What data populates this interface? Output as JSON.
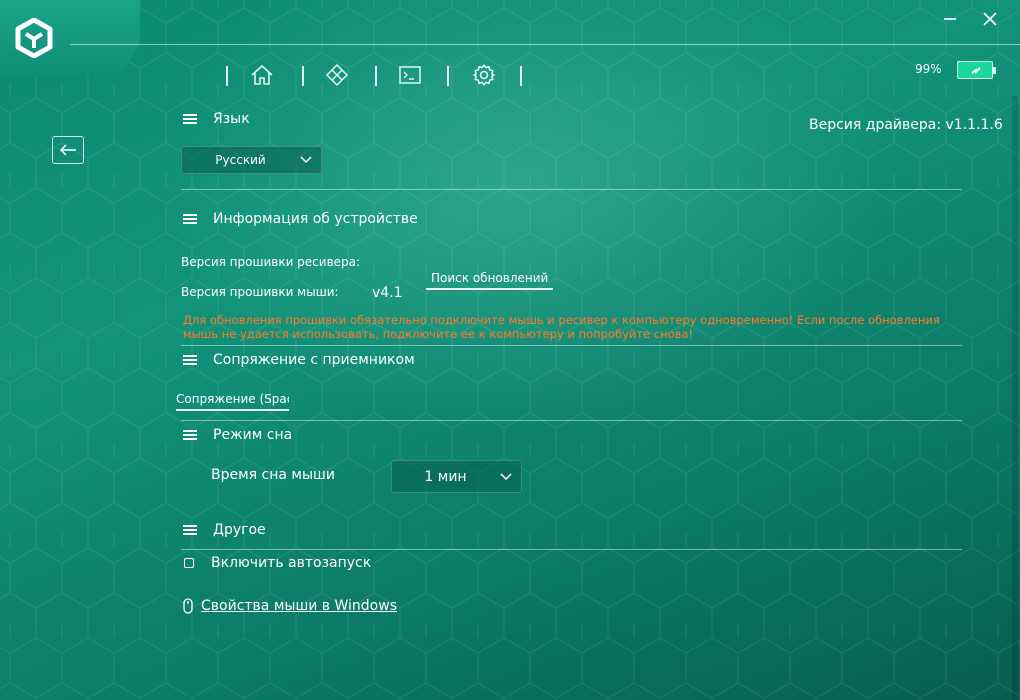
{
  "window": {
    "minimize_icon": "minimize-icon",
    "close_icon": "close-icon"
  },
  "nav": {
    "items": [
      {
        "icon": "home-icon"
      },
      {
        "icon": "diamond-grid-icon"
      },
      {
        "icon": "terminal-icon"
      },
      {
        "icon": "gear-icon"
      }
    ]
  },
  "battery": {
    "percent_label": "99%",
    "level": 0.99,
    "color": "#1ad79e"
  },
  "driver": {
    "version_label": "Версия драйвера: v1.1.1.6"
  },
  "language": {
    "title": "Язык",
    "selected": "Русский"
  },
  "device_info": {
    "title": "Информация об устройстве",
    "receiver_fw_label": "Версия прошивки ресивера:",
    "mouse_fw_label": "Версия прошивки мыши:",
    "mouse_fw_value": "v4.1",
    "check_updates_label": "Поиск обновлений",
    "warning_text": "Для обновления прошивки обязательно подключите мышь и ресивер к компьютеру одновременно! Если после обновления мышь не удается использовать, подключите ее к компьютеру и попробуйте снова!",
    "warning_color": "#ff7a2b"
  },
  "pairing": {
    "title": "Сопряжение с приемником",
    "pair_button_label": "Сопряжение (Space"
  },
  "sleep": {
    "title": "Режим сна",
    "time_label": "Время сна мыши",
    "selected": "1 мин"
  },
  "other": {
    "title": "Другое",
    "autostart_label": "Включить автозапуск",
    "autostart_checked": false,
    "mouse_properties_link": "Свойства мыши в Windows"
  },
  "colors": {
    "accent": "#0f8e76",
    "background_dark": "#075e50"
  }
}
